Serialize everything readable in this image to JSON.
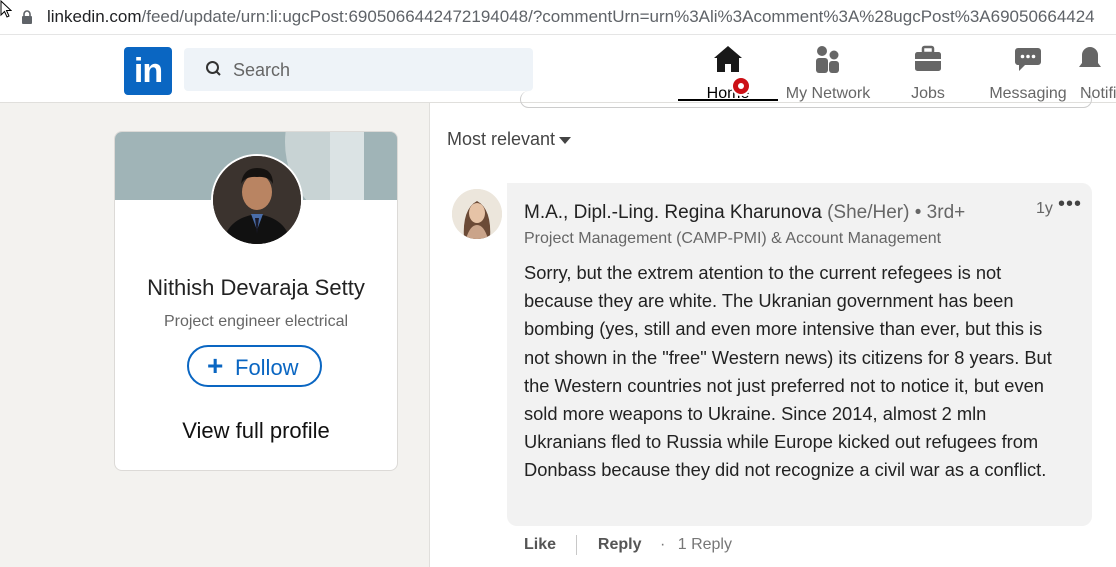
{
  "browser": {
    "url_host": "linkedin.com",
    "url_path": "/feed/update/urn:li:ugcPost:6905066442472194048/?commentUrn=urn%3Ali%3Acomment%3A%28ugcPost%3A69050664424"
  },
  "nav": {
    "logo_text": "in",
    "search_placeholder": "Search",
    "items": [
      {
        "label": "Home"
      },
      {
        "label": "My Network"
      },
      {
        "label": "Jobs"
      },
      {
        "label": "Messaging"
      },
      {
        "label": "Notifi"
      }
    ],
    "brand_color": "#0a66c2",
    "badge_color": "#cc1016"
  },
  "profile_card": {
    "name": "Nithish Devaraja Setty",
    "headline": "Project engineer electrical",
    "follow_label": "Follow",
    "view_profile_label": "View full profile"
  },
  "comments_section": {
    "sort_label": "Most relevant",
    "comment": {
      "author": "M.A., Dipl.-Ling. Regina Kharunova",
      "pronouns": "(She/Her)",
      "degree": "• 3rd+",
      "time": "1y",
      "more": "•••",
      "subtitle": "Project Management (CAMP-PMI) & Account Management",
      "body": "Sorry, but the extrem atention to the current refegees is not because they are white. The Ukranian government has been bombing (yes, still and even more intensive than ever, but this is not shown in the \"free\" Western news) its citizens for 8 years. But the Western countries not just preferred not to notice it, but even sold more weapons to Ukraine. Since 2014, almost 2 mln Ukranians fled to Russia while Europe kicked out refugees from Donbass because they did not recognize a civil war as a conflict.",
      "like_label": "Like",
      "reply_label": "Reply",
      "dot": "·",
      "replies_label": "1 Reply"
    }
  }
}
